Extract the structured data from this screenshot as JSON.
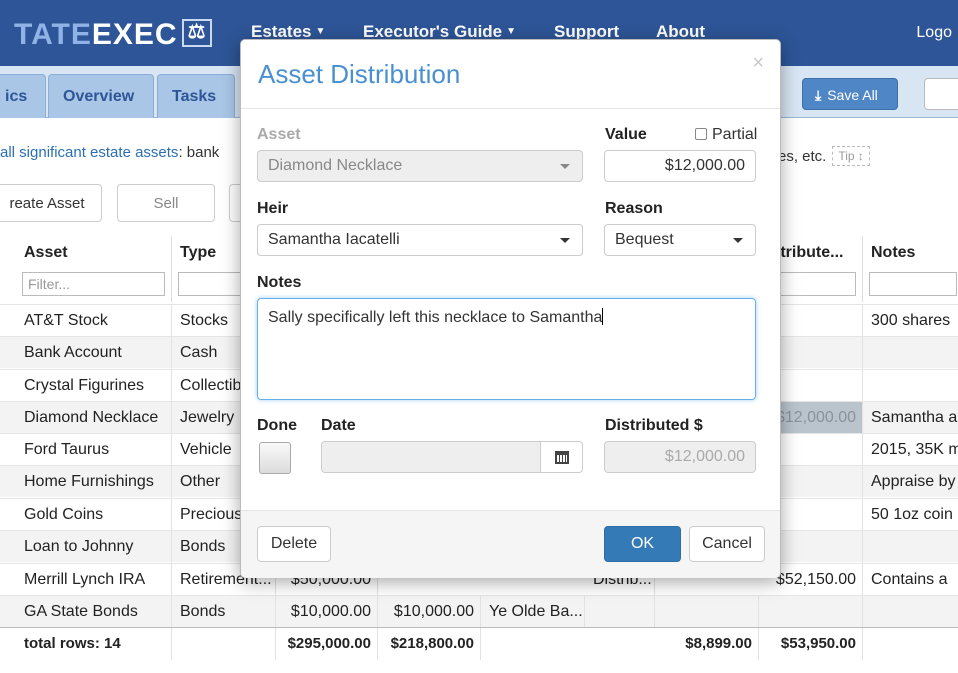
{
  "app": {
    "logo_left": "TATE",
    "logo_right": "EXEC",
    "nav": [
      "Estates",
      "Executor's Guide",
      "Support",
      "About"
    ],
    "logout": "Logo",
    "tabs": [
      "ics",
      "Overview",
      "Tasks"
    ],
    "save_all": "Save All",
    "intro_link": "all significant estate assets",
    "intro_text": ": bank",
    "intro_right": "es, etc.",
    "tip": "Tip",
    "create_asset": "reate Asset",
    "sell": "Sell"
  },
  "grid": {
    "columns": [
      "Asset",
      "Type",
      "istribute...",
      "Notes"
    ],
    "filter_placeholder": "Filter...",
    "filter_distributed": "<",
    "rows": [
      {
        "asset": "AT&T Stock",
        "type": "Stocks",
        "c1": "",
        "c2": "",
        "c3": "",
        "c4": "",
        "c5": "",
        "dist": "",
        "notes": "300 shares"
      },
      {
        "asset": "Bank Account",
        "type": "Cash",
        "c1": "",
        "c2": "",
        "c3": "",
        "c4": "",
        "c5": "",
        "dist": "",
        "notes": ""
      },
      {
        "asset": "Crystal Figurines",
        "type": "Collectib",
        "c1": "",
        "c2": "",
        "c3": "",
        "c4": "",
        "c5": "",
        "dist": "",
        "notes": ""
      },
      {
        "asset": "Diamond Necklace",
        "type": "Jewelry",
        "c1": "",
        "c2": "",
        "c3": "",
        "c4": "",
        "c5": "",
        "dist": "$12,000.00",
        "notes": "Samantha a"
      },
      {
        "asset": "Ford Taurus",
        "type": "Vehicle",
        "c1": "",
        "c2": "",
        "c3": "",
        "c4": "",
        "c5": "",
        "dist": "",
        "notes": "2015, 35K m"
      },
      {
        "asset": "Home Furnishings",
        "type": "Other",
        "c1": "",
        "c2": "",
        "c3": "",
        "c4": "",
        "c5": "",
        "dist": "",
        "notes": "Appraise by"
      },
      {
        "asset": "Gold Coins",
        "type": "Precious",
        "c1": "",
        "c2": "",
        "c3": "",
        "c4": "",
        "c5": "",
        "dist": "",
        "notes": "50 1oz coin"
      },
      {
        "asset": "Loan to Johnny",
        "type": "Bonds",
        "c1": "",
        "c2": "",
        "c3": "",
        "c4": "",
        "c5": "",
        "dist": "",
        "notes": ""
      },
      {
        "asset": "Merrill Lynch IRA",
        "type": "Retirement...",
        "c1": "$50,000.00",
        "c2": "",
        "c3": "",
        "c4": "Distrib...",
        "c5": "",
        "dist": "$52,150.00",
        "notes": "Contains a"
      },
      {
        "asset": "GA State Bonds",
        "type": "Bonds",
        "c1": "$10,000.00",
        "c2": "$10,000.00",
        "c3": "Ye Olde Ba...",
        "c4": "",
        "c5": "",
        "dist": "",
        "notes": ""
      }
    ],
    "totals": {
      "label": "total rows: 14",
      "c1": "$295,000.00",
      "c2": "$218,800.00",
      "c5": "$8,899.00",
      "dist": "$53,950.00"
    }
  },
  "modal": {
    "title": "Asset Distribution",
    "close": "×",
    "asset_label": "Asset",
    "asset_value": "Diamond Necklace",
    "value_label": "Value",
    "partial_label": "Partial",
    "value": "$12,000.00",
    "heir_label": "Heir",
    "heir_value": "Samantha Iacatelli",
    "reason_label": "Reason",
    "reason_value": "Bequest",
    "notes_label": "Notes",
    "notes_value": "Sally specifically left this necklace to Samantha",
    "done_label": "Done",
    "date_label": "Date",
    "distributed_label": "Distributed $",
    "distributed_value": "$12,000.00",
    "delete": "Delete",
    "ok": "OK",
    "cancel": "Cancel"
  }
}
